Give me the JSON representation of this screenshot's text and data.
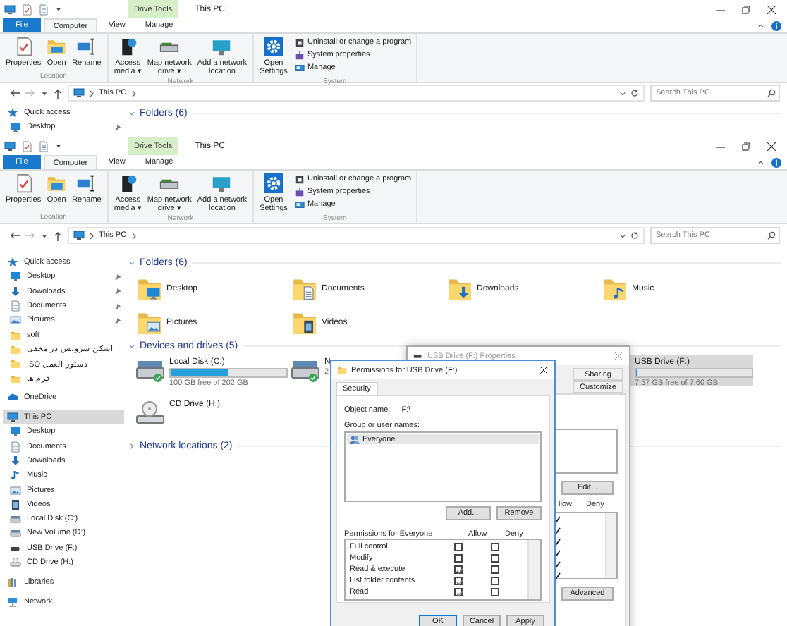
{
  "windows": [
    {
      "title": "This PC",
      "context_tab": "Drive Tools",
      "tabs": [
        {
          "label": "File",
          "kind": "file",
          "selected": false
        },
        {
          "label": "Computer",
          "kind": "tab",
          "selected": true
        },
        {
          "label": "View",
          "kind": "tab",
          "selected": false
        },
        {
          "label": "Manage",
          "kind": "tab",
          "selected": false
        }
      ],
      "ribbon": [
        {
          "label": "Location",
          "buttons": [
            {
              "lines": [
                "Properties"
              ],
              "kind": "properties"
            },
            {
              "lines": [
                "Open"
              ],
              "kind": "open"
            },
            {
              "lines": [
                "Rename"
              ],
              "kind": "rename"
            }
          ]
        },
        {
          "label": "Network",
          "buttons": [
            {
              "lines": [
                "Access",
                "media ▾"
              ],
              "kind": "media"
            },
            {
              "lines": [
                "Map network",
                "drive ▾"
              ],
              "kind": "mapdrive"
            },
            {
              "lines": [
                "Add a network",
                "location"
              ],
              "kind": "addloc"
            }
          ]
        },
        {
          "label": "System",
          "buttons": [
            {
              "lines": [
                "Open",
                "Settings"
              ],
              "kind": "settings"
            }
          ],
          "links": [
            {
              "label": "Uninstall or change a program",
              "kind": "uninstall"
            },
            {
              "label": "System properties",
              "kind": "sysprops"
            },
            {
              "label": "Manage",
              "kind": "manage"
            }
          ]
        }
      ],
      "address": [
        "This PC"
      ],
      "search": {
        "placeholder": "Search This PC"
      },
      "sidebar": [
        {
          "label": "Quick access",
          "kind": "star",
          "selected": false,
          "children": [
            {
              "label": "Desktop",
              "kind": "desktop",
              "selected": false,
              "pinned": true
            }
          ]
        }
      ],
      "sections": [
        {
          "title": "Folders (6)",
          "expanded": true
        }
      ]
    },
    {
      "title": "This PC",
      "context_tab": "Drive Tools",
      "tabs": [
        {
          "label": "File",
          "kind": "file",
          "selected": false
        },
        {
          "label": "Computer",
          "kind": "tab",
          "selected": true
        },
        {
          "label": "View",
          "kind": "tab",
          "selected": false
        },
        {
          "label": "Manage",
          "kind": "tab",
          "selected": false
        }
      ],
      "ribbon": [
        {
          "label": "Location",
          "buttons": [
            {
              "lines": [
                "Properties"
              ],
              "kind": "properties"
            },
            {
              "lines": [
                "Open"
              ],
              "kind": "open"
            },
            {
              "lines": [
                "Rename"
              ],
              "kind": "rename"
            }
          ]
        },
        {
          "label": "Network",
          "buttons": [
            {
              "lines": [
                "Access",
                "media ▾"
              ],
              "kind": "media"
            },
            {
              "lines": [
                "Map network",
                "drive ▾"
              ],
              "kind": "mapdrive"
            },
            {
              "lines": [
                "Add a network",
                "location"
              ],
              "kind": "addloc"
            }
          ]
        },
        {
          "label": "System",
          "buttons": [
            {
              "lines": [
                "Open",
                "Settings"
              ],
              "kind": "settings"
            }
          ],
          "links": [
            {
              "label": "Uninstall or change a program",
              "kind": "uninstall"
            },
            {
              "label": "System properties",
              "kind": "sysprops"
            },
            {
              "label": "Manage",
              "kind": "manage"
            }
          ]
        }
      ],
      "address": [
        "This PC"
      ],
      "search": {
        "placeholder": "Search This PC"
      },
      "sidebar": [
        {
          "label": "Quick access",
          "kind": "star",
          "selected": false,
          "children": [
            {
              "label": "Desktop",
              "kind": "desktop",
              "selected": false,
              "pinned": true
            },
            {
              "label": "Downloads",
              "kind": "download",
              "selected": false,
              "pinned": true
            },
            {
              "label": "Documents",
              "kind": "docs",
              "selected": false,
              "pinned": true
            },
            {
              "label": "Pictures",
              "kind": "pictures",
              "selected": false,
              "pinned": true
            },
            {
              "label": "soft",
              "kind": "folder",
              "selected": false,
              "pinned": false
            },
            {
              "label": "اسکن سرویس در مخفی",
              "kind": "folder",
              "selected": false,
              "pinned": false
            },
            {
              "label": "ISO دستور العمل",
              "kind": "folder",
              "selected": false,
              "pinned": false
            },
            {
              "label": "فرم ها",
              "kind": "folder",
              "selected": false,
              "pinned": false
            }
          ]
        },
        {
          "label": "OneDrive",
          "kind": "cloud",
          "selected": false
        },
        {
          "label": "This PC",
          "kind": "pc",
          "selected": true,
          "children": [
            {
              "label": "Desktop",
              "kind": "desktop",
              "selected": false
            },
            {
              "label": "Documents",
              "kind": "docs",
              "selected": false
            },
            {
              "label": "Downloads",
              "kind": "download",
              "selected": false
            },
            {
              "label": "Music",
              "kind": "music",
              "selected": false
            },
            {
              "label": "Pictures",
              "kind": "pictures",
              "selected": false
            },
            {
              "label": "Videos",
              "kind": "videos",
              "selected": false
            },
            {
              "label": "Local Disk (C:)",
              "kind": "hdd",
              "selected": false
            },
            {
              "label": "New Volume (D:)",
              "kind": "hdd",
              "selected": false
            },
            {
              "label": "USB Drive (F:)",
              "kind": "usb",
              "selected": false
            },
            {
              "label": "CD Drive (H:)",
              "kind": "cd",
              "selected": false
            }
          ]
        },
        {
          "label": "Libraries",
          "kind": "library",
          "selected": false
        },
        {
          "label": "Network",
          "kind": "network",
          "selected": false
        }
      ],
      "sections": [
        {
          "title": "Folders (6)",
          "expanded": true,
          "kind": "folders",
          "items": [
            {
              "label": "Desktop",
              "kind": "desktop"
            },
            {
              "label": "Documents",
              "kind": "docs"
            },
            {
              "label": "Downloads",
              "kind": "download"
            },
            {
              "label": "Music",
              "kind": "music"
            },
            {
              "label": "Pictures",
              "kind": "pictures"
            },
            {
              "label": "Videos",
              "kind": "videos"
            }
          ]
        },
        {
          "title": "Devices and drives (5)",
          "expanded": true,
          "kind": "drives",
          "items": [
            {
              "label": "Local Disk (C:)",
              "kind": "hdd",
              "level": 0.5,
              "free": "100 GB free of 202 GB",
              "selected": false
            },
            {
              "label": "N",
              "kind": "hdd",
              "free": "2",
              "selected": false
            },
            {
              "label": "USB Drive (F:)",
              "kind": "usb",
              "level": 0.004,
              "free": "7.57 GB free of 7.60 GB",
              "selected": true
            },
            {
              "label": "CD Drive (H:)",
              "kind": "cd",
              "selected": false
            }
          ]
        },
        {
          "title": "Network locations (2)",
          "expanded": false
        }
      ]
    }
  ],
  "properties_dialog": {
    "title": "USB Drive (F:) Properties",
    "tabs": [
      {
        "label": "Sharing",
        "selected": false
      },
      {
        "label": "Customize",
        "selected": false
      }
    ],
    "edit_button": "Edit...",
    "columns": [
      "llow",
      "Deny"
    ],
    "permissions": [
      {
        "allow": true
      },
      {
        "allow": true
      },
      {
        "allow": true
      },
      {
        "allow": true
      },
      {
        "allow": true
      },
      {
        "allow": true
      }
    ],
    "advanced_button": "Advanced"
  },
  "permissions_dialog": {
    "title": "Permissions for USB Drive (F:)",
    "tabs": [
      {
        "label": "Security",
        "selected": true
      }
    ],
    "object_label": "Object name:",
    "object_value": "F:\\",
    "group_label": "Group or user names:",
    "users": [
      {
        "label": "Everyone",
        "selected": true
      }
    ],
    "buttons": [
      "Add...",
      "Remove"
    ],
    "perm_label": "Permissions for Everyone",
    "columns": [
      "Allow",
      "Deny"
    ],
    "permissions": [
      {
        "label": "Full control",
        "allow": false,
        "deny": false
      },
      {
        "label": "Modify",
        "allow": false,
        "deny": false
      },
      {
        "label": "Read & execute",
        "allow": true,
        "deny": false
      },
      {
        "label": "List folder contents",
        "allow": true,
        "deny": false
      },
      {
        "label": "Read",
        "allow": true,
        "deny": false
      }
    ],
    "footer_buttons": [
      {
        "label": "OK",
        "default": true
      },
      {
        "label": "Cancel",
        "default": false
      },
      {
        "label": "Apply",
        "default": false
      }
    ]
  }
}
